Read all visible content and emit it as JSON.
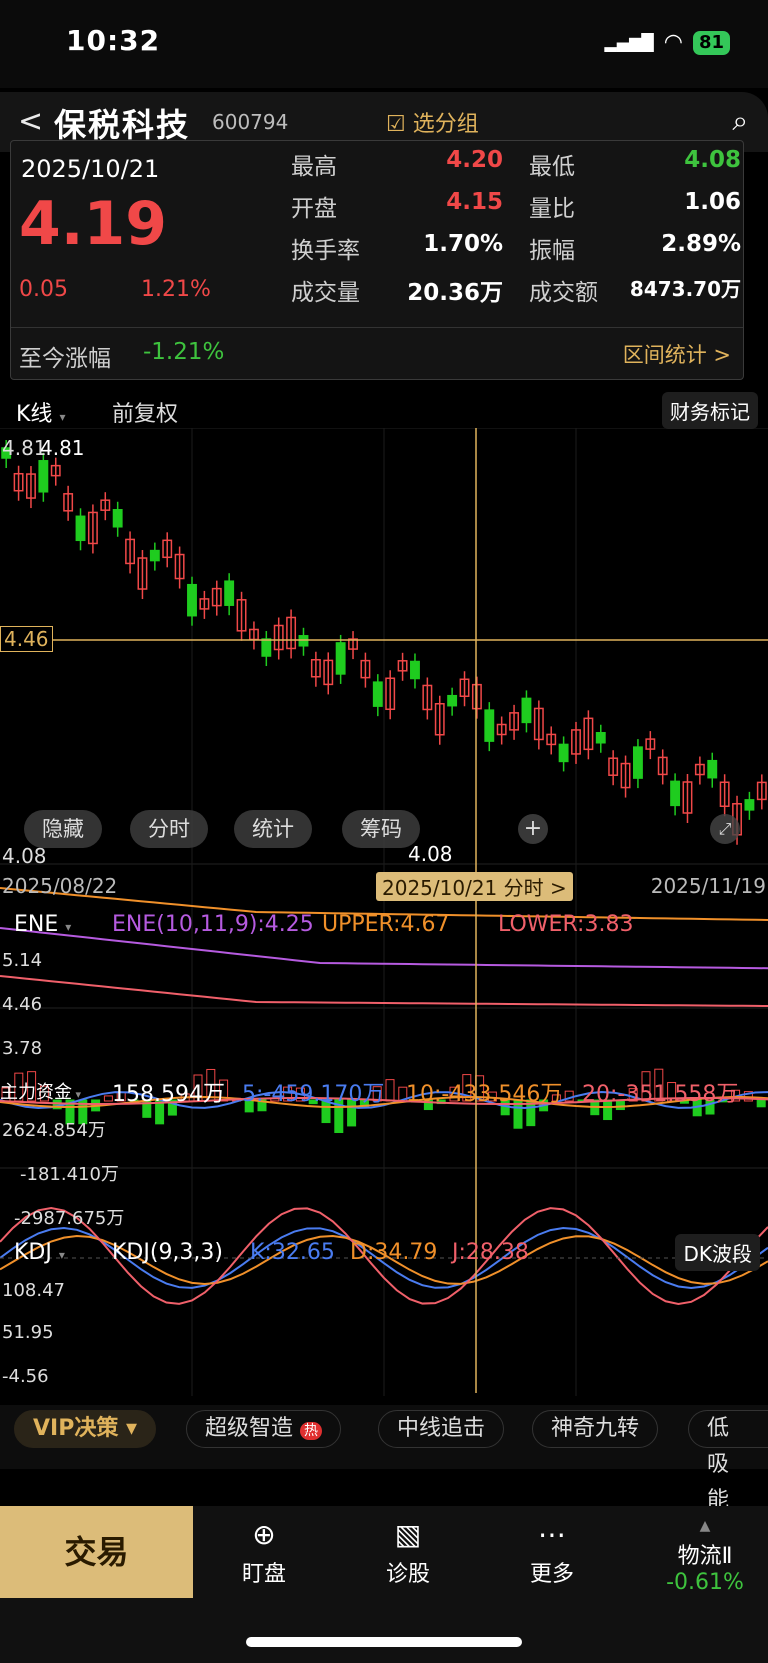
{
  "status": {
    "time": "10:32",
    "battery": "81"
  },
  "header": {
    "back": "<",
    "name": "保税科技",
    "code": "600794",
    "group_label": "选分组"
  },
  "quote": {
    "date": "2025/10/21",
    "price": "4.19",
    "change": "0.05",
    "change_pct": "1.21%",
    "high_label": "最高",
    "high": "4.20",
    "low_label": "最低",
    "low": "4.08",
    "open_label": "开盘",
    "open": "4.15",
    "vol_ratio_label": "量比",
    "vol_ratio": "1.06",
    "turnover_label": "换手率",
    "turnover": "1.70%",
    "amplitude_label": "振幅",
    "amplitude": "2.89%",
    "volume_label": "成交量",
    "volume": "20.36万",
    "amount_label": "成交额",
    "amount": "8473.70万",
    "since_label": "至今涨幅",
    "since": "-1.21%",
    "range_label": "区间统计 >"
  },
  "kline": {
    "tab": "K线",
    "adjust": "前复权",
    "finance_mark": "财务标记",
    "high_left": "4.81",
    "high_label": "4.81",
    "cross_price": "4.46",
    "low_left": "4.08",
    "low_label": "4.08",
    "start_date": "2025/08/22",
    "end_date": "2025/11/19",
    "cursor_label": "2025/10/21 分时 >",
    "pills": [
      "隐藏",
      "分时",
      "统计",
      "筹码"
    ]
  },
  "ene": {
    "name": "ENE",
    "params": "ENE(10,11,9):4.25",
    "upper": "UPPER:4.67",
    "lower": "LOWER:3.83",
    "ticks": [
      "5.14",
      "4.46",
      "3.78"
    ]
  },
  "fund": {
    "name": "主力资金",
    "value": "158.594万",
    "ma5": "5:-459.170万",
    "ma10": "10:-433.546万",
    "ma20": "20:-351.558万",
    "ticks": [
      "2624.854万",
      "-181.410万",
      "-2987.675万"
    ]
  },
  "kdj": {
    "name": "KDJ",
    "params": "KDJ(9,3,3)",
    "k": "K:32.65",
    "d": "D:34.79",
    "j": "J:28.38",
    "button": "DK波段",
    "ticks": [
      "108.47",
      "51.95",
      "-4.56"
    ]
  },
  "chips": {
    "vip": "VIP决策",
    "items": [
      "超级智造",
      "中线追击",
      "神奇九转",
      "低吸能"
    ],
    "hot": "热"
  },
  "nav": {
    "trade": "交易",
    "items": [
      "盯盘",
      "诊股",
      "更多"
    ],
    "sector": "物流Ⅱ",
    "sector_pct": "-0.61%"
  },
  "colors": {
    "up": "#f04848",
    "down": "#3ec33e",
    "gold": "#e0b35c"
  }
}
